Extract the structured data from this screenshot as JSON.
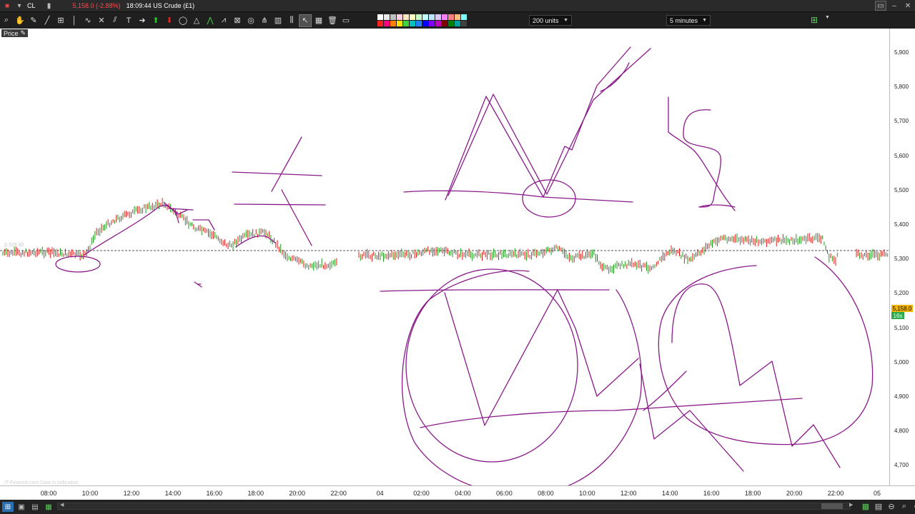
{
  "titlebar": {
    "symbol": "CL",
    "change": "5,158.0 (-2.88%)",
    "time_instrument": "18:09:44 US Crude (£1)",
    "icons": [
      "app-icon",
      "menu-icon",
      "chart-icon"
    ],
    "window_controls": [
      "restore-icon",
      "minimize-icon",
      "close-icon"
    ]
  },
  "toolbar": {
    "tools": [
      "zoom-icon",
      "hand-icon",
      "pencil-icon",
      "line-icon",
      "fib-icon",
      "vertical-line-icon",
      "wave-icon",
      "cross-icon",
      "channel-icon",
      "text-icon",
      "arrow-right-icon",
      "arrow-up-icon",
      "arrow-down-icon",
      "ellipse-icon",
      "triangle-icon",
      "zigzag-icon",
      "pattern-icon",
      "gann-icon",
      "arc-icon",
      "pitchfork-icon",
      "bars-icon",
      "cursor-icon",
      "grid-icon",
      "trash-icon",
      "rectangle-icon"
    ],
    "units_select": "200 units",
    "interval_select": "5 minutes",
    "palette_colors": [
      "#ffffff",
      "#e8e8e8",
      "#c0c0c0",
      "#ffd0e0",
      "#ffe8c0",
      "#ffffc0",
      "#c8ffc8",
      "#c0ffff",
      "#c0e0ff",
      "#d8c8ff",
      "#ff80ff",
      "#ff8080",
      "#ffc080",
      "#80ffff",
      "#ff2020",
      "#ff0080",
      "#ff8000",
      "#ffe000",
      "#40d040",
      "#00c0c0",
      "#2080ff",
      "#0000ff",
      "#8000ff",
      "#c000c0",
      "#800000",
      "#008000",
      "#00a0a0",
      "#404040"
    ]
  },
  "chart": {
    "price_tag": "Price",
    "ghost_price": "5,328.30",
    "watermark": "IT-Finance.com Data is indicative",
    "y_axis_labels": [
      "5,900",
      "5,800",
      "5,700",
      "5,600",
      "5,500",
      "5,400",
      "5,300",
      "5,200",
      "5,100",
      "5,000",
      "4,900",
      "4,800",
      "4,700"
    ],
    "x_axis_labels": [
      "08:00",
      "10:00",
      "12:00",
      "14:00",
      "16:00",
      "18:00",
      "20:00",
      "22:00",
      "04",
      "02:00",
      "04:00",
      "06:00",
      "08:00",
      "10:00",
      "12:00",
      "14:00",
      "16:00",
      "18:00",
      "20:00",
      "22:00",
      "05"
    ],
    "last_price": "5,158.0",
    "countdown": "16s",
    "colors": {
      "up": "#1a9a1a",
      "down": "#e01818",
      "annotation": "#8a1a8a",
      "last_price_bg": "#f0b400",
      "countdown_bg": "#2aa84a"
    }
  },
  "bottombar": {
    "icons": [
      "windows-icon",
      "layout-icon",
      "list-icon",
      "green-grid-icon"
    ],
    "scroll_left": "◀",
    "scroll_right": "▶",
    "zoom_icons": [
      "chart-settings-icon",
      "grid-view-icon",
      "zoom-out-icon",
      "zoom-fit-icon",
      "zoom-in-icon"
    ]
  }
}
